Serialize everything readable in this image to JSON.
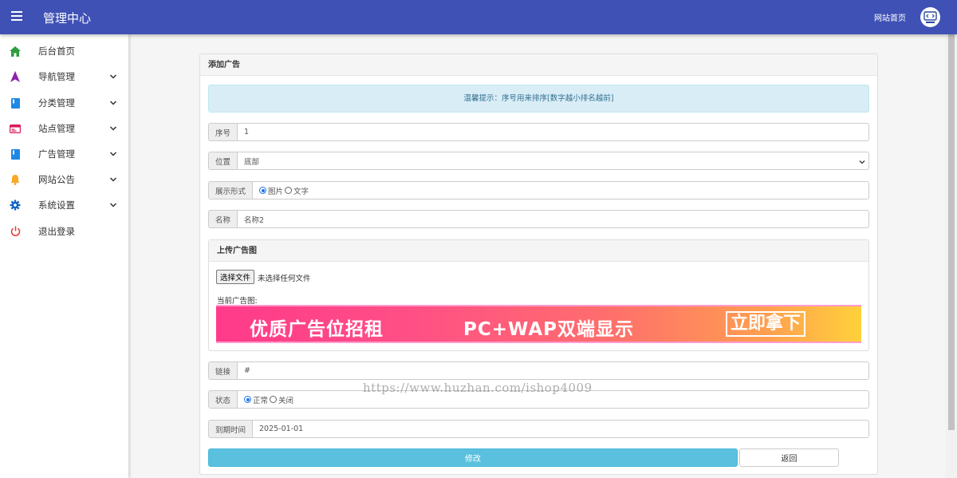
{
  "header": {
    "title": "管理中心",
    "home_link": "网站首页",
    "colors": {
      "topbar": "#3f51b5"
    }
  },
  "sidebar": {
    "items": [
      {
        "label": "后台首页",
        "icon": "home-icon",
        "color": "#2e9d3e",
        "expandable": false
      },
      {
        "label": "导航管理",
        "icon": "navigation-icon",
        "color": "#8e24aa",
        "expandable": true
      },
      {
        "label": "分类管理",
        "icon": "book-icon",
        "color": "#1e88e5",
        "expandable": true
      },
      {
        "label": "站点管理",
        "icon": "web-icon",
        "color": "#d81b60",
        "expandable": true
      },
      {
        "label": "广告管理",
        "icon": "book-icon",
        "color": "#1e88e5",
        "expandable": true
      },
      {
        "label": "网站公告",
        "icon": "bell-icon",
        "color": "#f9a825",
        "expandable": true
      },
      {
        "label": "系统设置",
        "icon": "gear-icon",
        "color": "#1565c0",
        "expandable": true
      },
      {
        "label": "退出登录",
        "icon": "power-icon",
        "color": "#e53935",
        "expandable": false
      }
    ]
  },
  "form": {
    "title": "添加广告",
    "tip": "温馨提示：序号用来排序[数字越小排名越前]",
    "order": {
      "label": "序号",
      "value": "1"
    },
    "position": {
      "label": "位置",
      "value": "底部"
    },
    "display": {
      "label": "展示形式",
      "options": [
        "图片",
        "文字"
      ],
      "selected": "图片"
    },
    "name": {
      "label": "名称",
      "value": "名称2"
    },
    "upload": {
      "title": "上传广告图",
      "button": "选择文件",
      "no_file": "未选择任何文件",
      "current_label": "当前广告图:",
      "banner": {
        "text1": "优质广告位招租",
        "text2": "PC+WAP双端显示",
        "text3": "立即拿下"
      }
    },
    "link": {
      "label": "链接",
      "value": "#"
    },
    "status": {
      "label": "状态",
      "options": [
        "正常",
        "关闭"
      ],
      "selected": "正常"
    },
    "expire": {
      "label": "到期时间",
      "value": "2025-01-01"
    },
    "submit_label": "修改",
    "back_label": "返回"
  },
  "watermark": "https://www.huzhan.com/ishop4009"
}
